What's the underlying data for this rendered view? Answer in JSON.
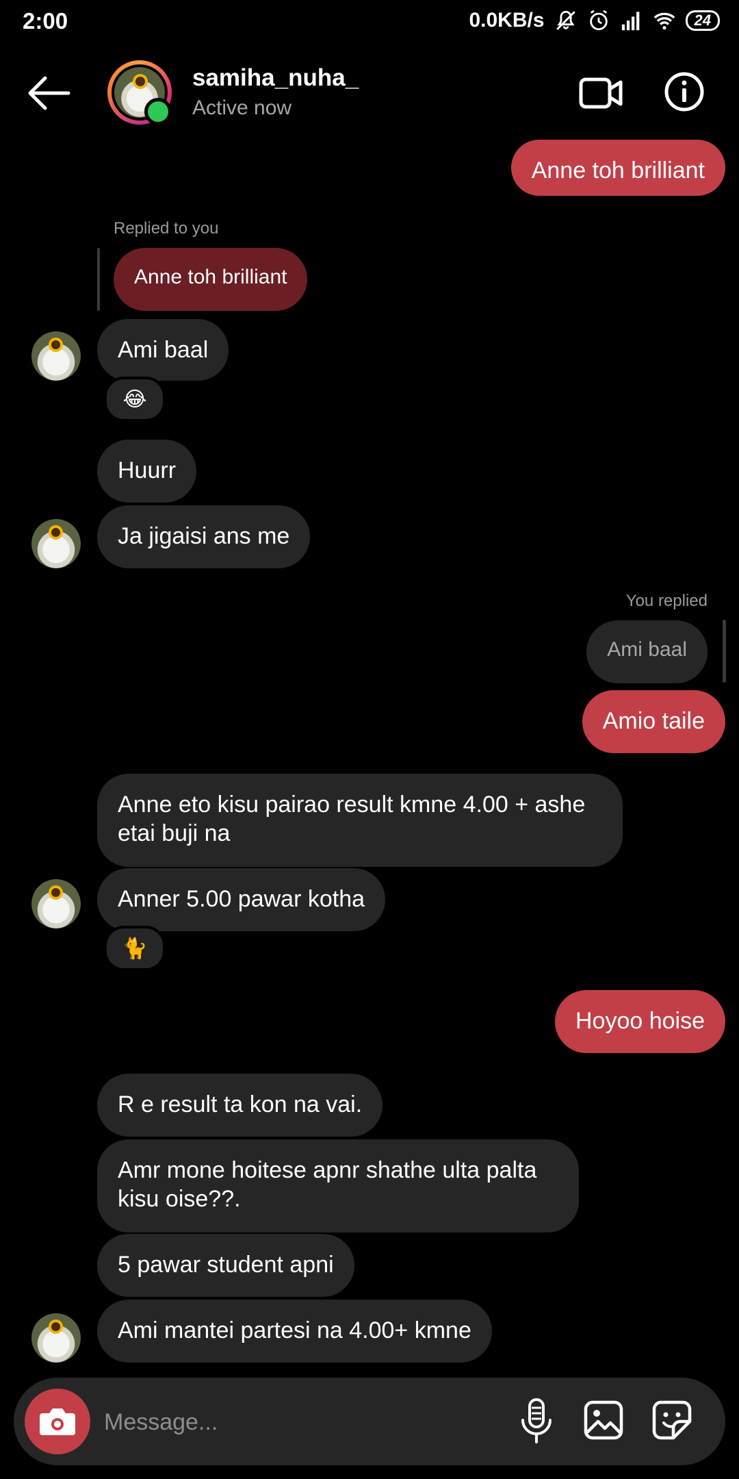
{
  "status_bar": {
    "time": "2:00",
    "net_speed": "0.0KB/s",
    "battery": "24"
  },
  "header": {
    "username": "samiha_nuha_",
    "status": "Active now",
    "online_color": "#2ec954"
  },
  "thread": {
    "top_sent": "Anne toh brilliant",
    "replied_label": "Replied to you",
    "reply_quote_in": "Anne toh brilliant",
    "msg_ami_baal": "Ami baal",
    "reaction_1": "😂",
    "msg_huurr": "Huurr",
    "msg_ja": "Ja jigaisi ans me",
    "you_replied_label": "You replied",
    "reply_quote_out": "Ami baal",
    "msg_amio": "Amio taile",
    "msg_anne_eto": "Anne eto kisu pairao result kmne 4.00 + ashe etai buji na",
    "msg_anner": "Anner 5.00 pawar kotha",
    "reaction_2": "🐈",
    "msg_hoyoo": "Hoyoo hoise",
    "msg_r_e": "R e result ta kon na vai.",
    "msg_amr_mone": "Amr mone hoitese apnr shathe ulta palta kisu oise??.",
    "msg_5_pawar": "5 pawar student apni",
    "msg_ami_mantei": "Ami mantei partesi na 4.00+ kmne"
  },
  "composer": {
    "placeholder": "Message..."
  },
  "colors": {
    "sent_bubble": "#c23f47",
    "received_bubble": "#262626",
    "background": "#000000"
  }
}
